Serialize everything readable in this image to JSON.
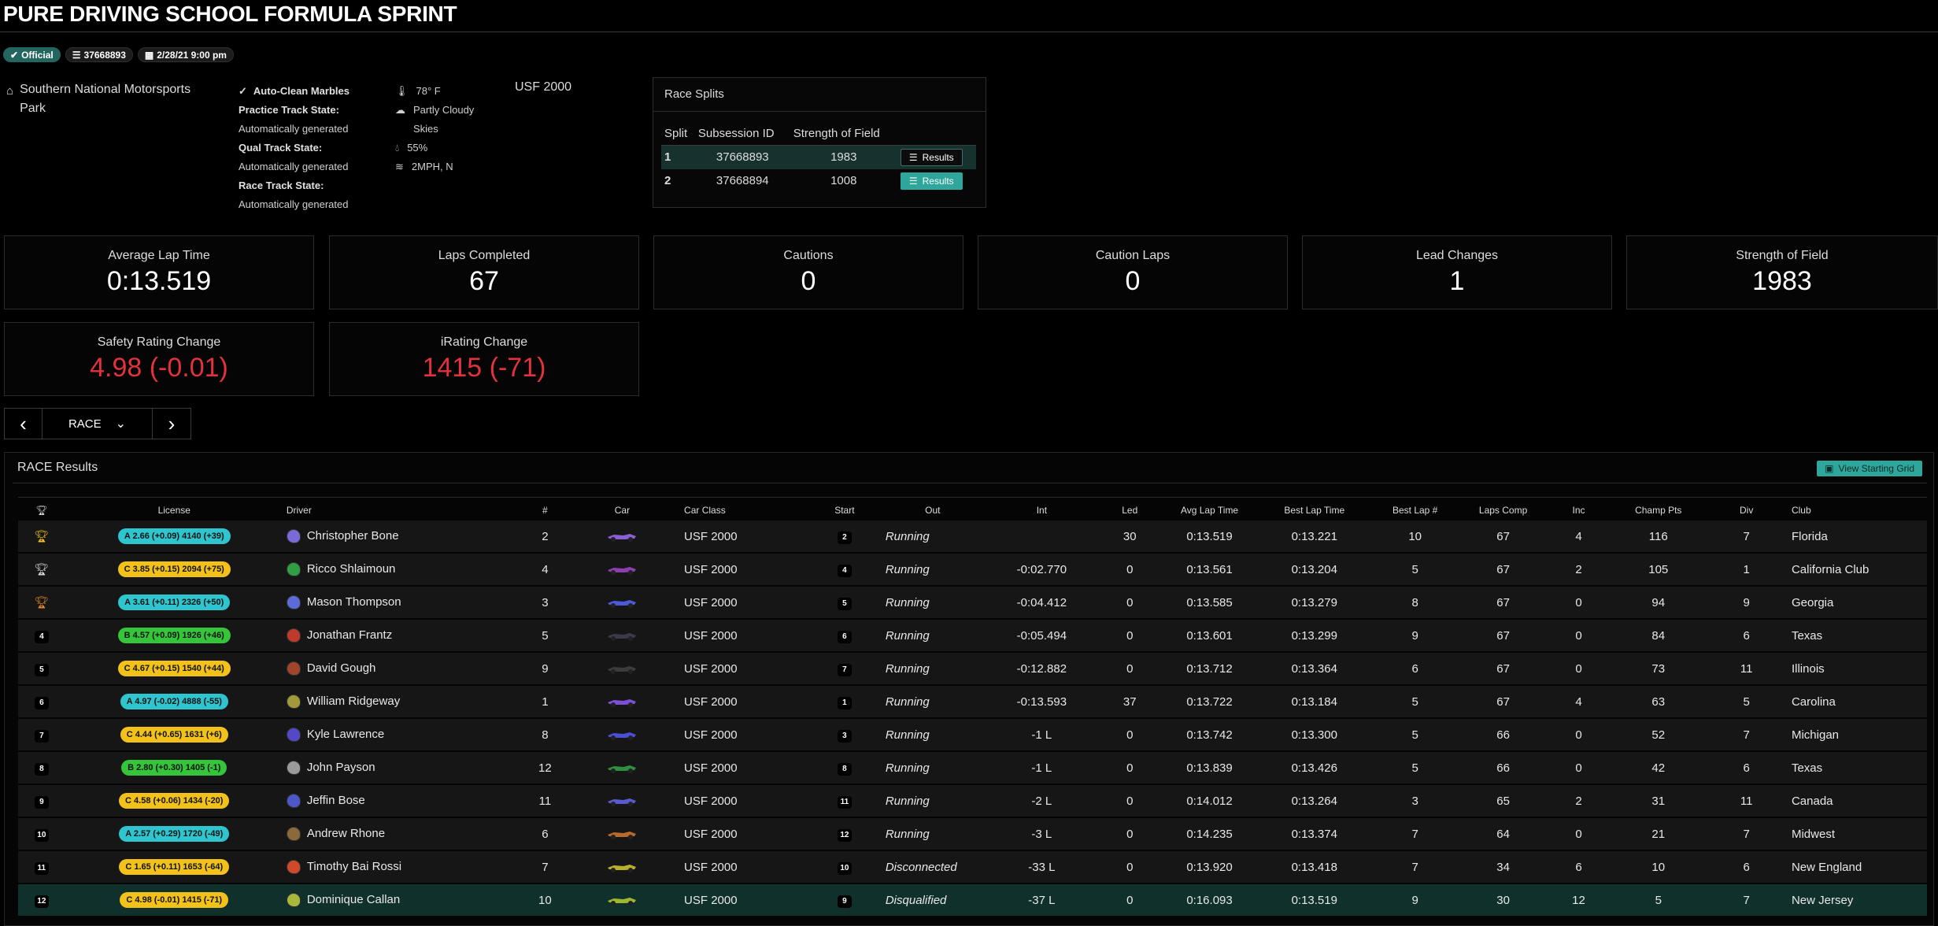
{
  "event": {
    "title": "PURE DRIVING SCHOOL FORMULA SPRINT",
    "badges": {
      "official": "Official",
      "session_id": "37668893",
      "datetime": "2/28/21 9:00 pm"
    },
    "track": "Southern National Motorsports Park",
    "conditions": {
      "auto_clean": "Auto-Clean Marbles",
      "practice_label": "Practice Track State:",
      "practice_value": "Automatically generated",
      "qual_label": "Qual Track State:",
      "qual_value": "Automatically generated",
      "race_label": "Race Track State:",
      "race_value": "Automatically generated"
    },
    "weather": {
      "temp": "78° F",
      "sky": "Partly Cloudy Skies",
      "humidity": "55%",
      "wind": "2MPH, N"
    },
    "car_class": "USF 2000"
  },
  "splits": {
    "title": "Race Splits",
    "headers": [
      "Split",
      "Subsession ID",
      "Strength of Field"
    ],
    "rows": [
      {
        "split": "1",
        "id": "37668893",
        "sof": "1983",
        "btn": "Results"
      },
      {
        "split": "2",
        "id": "37668894",
        "sof": "1008",
        "btn": "Results"
      }
    ]
  },
  "stats": [
    {
      "label": "Average Lap Time",
      "value": "0:13.519"
    },
    {
      "label": "Laps Completed",
      "value": "67"
    },
    {
      "label": "Cautions",
      "value": "0"
    },
    {
      "label": "Caution Laps",
      "value": "0"
    },
    {
      "label": "Lead Changes",
      "value": "1"
    },
    {
      "label": "Strength of Field",
      "value": "1983"
    },
    {
      "label": "Safety Rating Change",
      "value": "4.98 (-0.01)"
    },
    {
      "label": "iRating Change",
      "value": "1415 (-71)"
    }
  ],
  "session_nav": {
    "prev": "‹",
    "current": "RACE",
    "next": "›"
  },
  "results": {
    "title": "RACE Results",
    "grid_button": "View Starting Grid",
    "columns": [
      "",
      "License",
      "Driver",
      "#",
      "Car",
      "Car Class",
      "Start",
      "Out",
      "Int",
      "Led",
      "Avg Lap Time",
      "Best Lap Time",
      "Best Lap #",
      "Laps Comp",
      "Inc",
      "Champ Pts",
      "Div",
      "Club"
    ],
    "rows": [
      {
        "pos": "1",
        "lic": "A 2.66 (+0.09) 4140 (+39)",
        "lic_color": "#2ec5cf",
        "driver": "Christopher Bone",
        "num": "2",
        "car_color": "#8a5fd6",
        "cls": "USF 2000",
        "start": "2",
        "out": "Running",
        "int": "",
        "led": "30",
        "avg": "0:13.519",
        "best": "0:13.221",
        "best_lap": "10",
        "laps": "67",
        "inc": "4",
        "pts": "116",
        "div": "7",
        "club": "Florida",
        "helmet": "#7b6bd8"
      },
      {
        "pos": "2",
        "lic": "C 3.85 (+0.15) 2094 (+75)",
        "lic_color": "#f2c21b",
        "driver": "Ricco Shlaimoun",
        "num": "4",
        "car_color": "#8d3fb0",
        "cls": "USF 2000",
        "start": "4",
        "out": "Running",
        "int": "-0:02.770",
        "led": "0",
        "avg": "0:13.561",
        "best": "0:13.204",
        "best_lap": "5",
        "laps": "67",
        "inc": "2",
        "pts": "105",
        "div": "1",
        "club": "California Club",
        "helmet": "#2f9e44"
      },
      {
        "pos": "3",
        "lic": "A 3.61 (+0.11) 2326 (+50)",
        "lic_color": "#2ec5cf",
        "driver": "Mason Thompson",
        "num": "3",
        "car_color": "#4a5ad8",
        "cls": "USF 2000",
        "start": "5",
        "out": "Running",
        "int": "-0:04.412",
        "led": "0",
        "avg": "0:13.585",
        "best": "0:13.279",
        "best_lap": "8",
        "laps": "67",
        "inc": "0",
        "pts": "94",
        "div": "9",
        "club": "Georgia",
        "helmet": "#5b6cd8"
      },
      {
        "pos": "4",
        "lic": "B 4.57 (+0.09) 1926 (+46)",
        "lic_color": "#35c53a",
        "driver": "Jonathan Frantz",
        "num": "5",
        "car_color": "#3a3a4a",
        "cls": "USF 2000",
        "start": "6",
        "out": "Running",
        "int": "-0:05.494",
        "led": "0",
        "avg": "0:13.601",
        "best": "0:13.299",
        "best_lap": "9",
        "laps": "67",
        "inc": "0",
        "pts": "84",
        "div": "6",
        "club": "Texas",
        "helmet": "#c0392b"
      },
      {
        "pos": "5",
        "lic": "C 4.67 (+0.15) 1540 (+44)",
        "lic_color": "#f2c21b",
        "driver": "David Gough",
        "num": "9",
        "car_color": "#3c3c3c",
        "cls": "USF 2000",
        "start": "7",
        "out": "Running",
        "int": "-0:12.882",
        "led": "0",
        "avg": "0:13.712",
        "best": "0:13.364",
        "best_lap": "6",
        "laps": "67",
        "inc": "0",
        "pts": "73",
        "div": "11",
        "club": "Illinois",
        "helmet": "#a0452a"
      },
      {
        "pos": "6",
        "lic": "A 4.97 (-0.02) 4888 (-55)",
        "lic_color": "#2ec5cf",
        "driver": "William Ridgeway",
        "num": "1",
        "car_color": "#7d4fd6",
        "cls": "USF 2000",
        "start": "1",
        "out": "Running",
        "int": "-0:13.593",
        "led": "37",
        "avg": "0:13.722",
        "best": "0:13.184",
        "best_lap": "5",
        "laps": "67",
        "inc": "4",
        "pts": "63",
        "div": "5",
        "club": "Carolina",
        "helmet": "#a09a3a"
      },
      {
        "pos": "7",
        "lic": "C 4.44 (+0.65) 1631 (+6)",
        "lic_color": "#f2c21b",
        "driver": "Kyle Lawrence",
        "num": "8",
        "car_color": "#4b4fd6",
        "cls": "USF 2000",
        "start": "3",
        "out": "Running",
        "int": "-1 L",
        "led": "0",
        "avg": "0:13.742",
        "best": "0:13.300",
        "best_lap": "5",
        "laps": "66",
        "inc": "0",
        "pts": "52",
        "div": "7",
        "club": "Michigan",
        "helmet": "#5548c8"
      },
      {
        "pos": "8",
        "lic": "B 2.80 (+0.30) 1405 (-1)",
        "lic_color": "#35c53a",
        "driver": "John Payson",
        "num": "12",
        "car_color": "#2f8f3f",
        "cls": "USF 2000",
        "start": "8",
        "out": "Running",
        "int": "-1 L",
        "led": "0",
        "avg": "0:13.839",
        "best": "0:13.426",
        "best_lap": "5",
        "laps": "66",
        "inc": "0",
        "pts": "42",
        "div": "6",
        "club": "Texas",
        "helmet": "#9a9a9a"
      },
      {
        "pos": "9",
        "lic": "C 4.58 (+0.06) 1434 (-20)",
        "lic_color": "#f2c21b",
        "driver": "Jeffin Bose",
        "num": "11",
        "car_color": "#5a5ad0",
        "cls": "USF 2000",
        "start": "11",
        "out": "Running",
        "int": "-2 L",
        "led": "0",
        "avg": "0:14.012",
        "best": "0:13.264",
        "best_lap": "3",
        "laps": "65",
        "inc": "2",
        "pts": "31",
        "div": "11",
        "club": "Canada",
        "helmet": "#4c58c8"
      },
      {
        "pos": "10",
        "lic": "A 2.57 (+0.29) 1720 (-49)",
        "lic_color": "#2ec5cf",
        "driver": "Andrew Rhone",
        "num": "6",
        "car_color": "#b8692c",
        "cls": "USF 2000",
        "start": "12",
        "out": "Running",
        "int": "-3 L",
        "led": "0",
        "avg": "0:14.235",
        "best": "0:13.374",
        "best_lap": "7",
        "laps": "64",
        "inc": "0",
        "pts": "21",
        "div": "7",
        "club": "Midwest",
        "helmet": "#8a6a3a"
      },
      {
        "pos": "11",
        "lic": "C 1.65 (+0.11) 1653 (-64)",
        "lic_color": "#f2c21b",
        "driver": "Timothy Bai Rossi",
        "num": "7",
        "car_color": "#b8b02c",
        "cls": "USF 2000",
        "start": "10",
        "out": "Disconnected",
        "int": "-33 L",
        "led": "0",
        "avg": "0:13.920",
        "best": "0:13.418",
        "best_lap": "7",
        "laps": "34",
        "inc": "6",
        "pts": "10",
        "div": "6",
        "club": "New England",
        "helmet": "#d04a2a"
      },
      {
        "pos": "12",
        "lic": "C 4.98 (-0.01) 1415 (-71)",
        "lic_color": "#f2c21b",
        "driver": "Dominique Callan",
        "num": "10",
        "car_color": "#9db82c",
        "cls": "USF 2000",
        "start": "9",
        "out": "Disqualified",
        "int": "-37 L",
        "led": "0",
        "avg": "0:16.093",
        "best": "0:13.519",
        "best_lap": "9",
        "laps": "30",
        "inc": "12",
        "pts": "5",
        "div": "7",
        "club": "New Jersey",
        "helmet": "#a8b83a"
      }
    ]
  },
  "colors": {
    "accent": "#2ea69b",
    "highlight": "#10302c",
    "negative": "#e2323c",
    "fastest": "#f2c12e",
    "trophy_gold": "#f2c21b",
    "trophy_silver": "#d8d8d8",
    "trophy_bronze": "#e0882a"
  }
}
